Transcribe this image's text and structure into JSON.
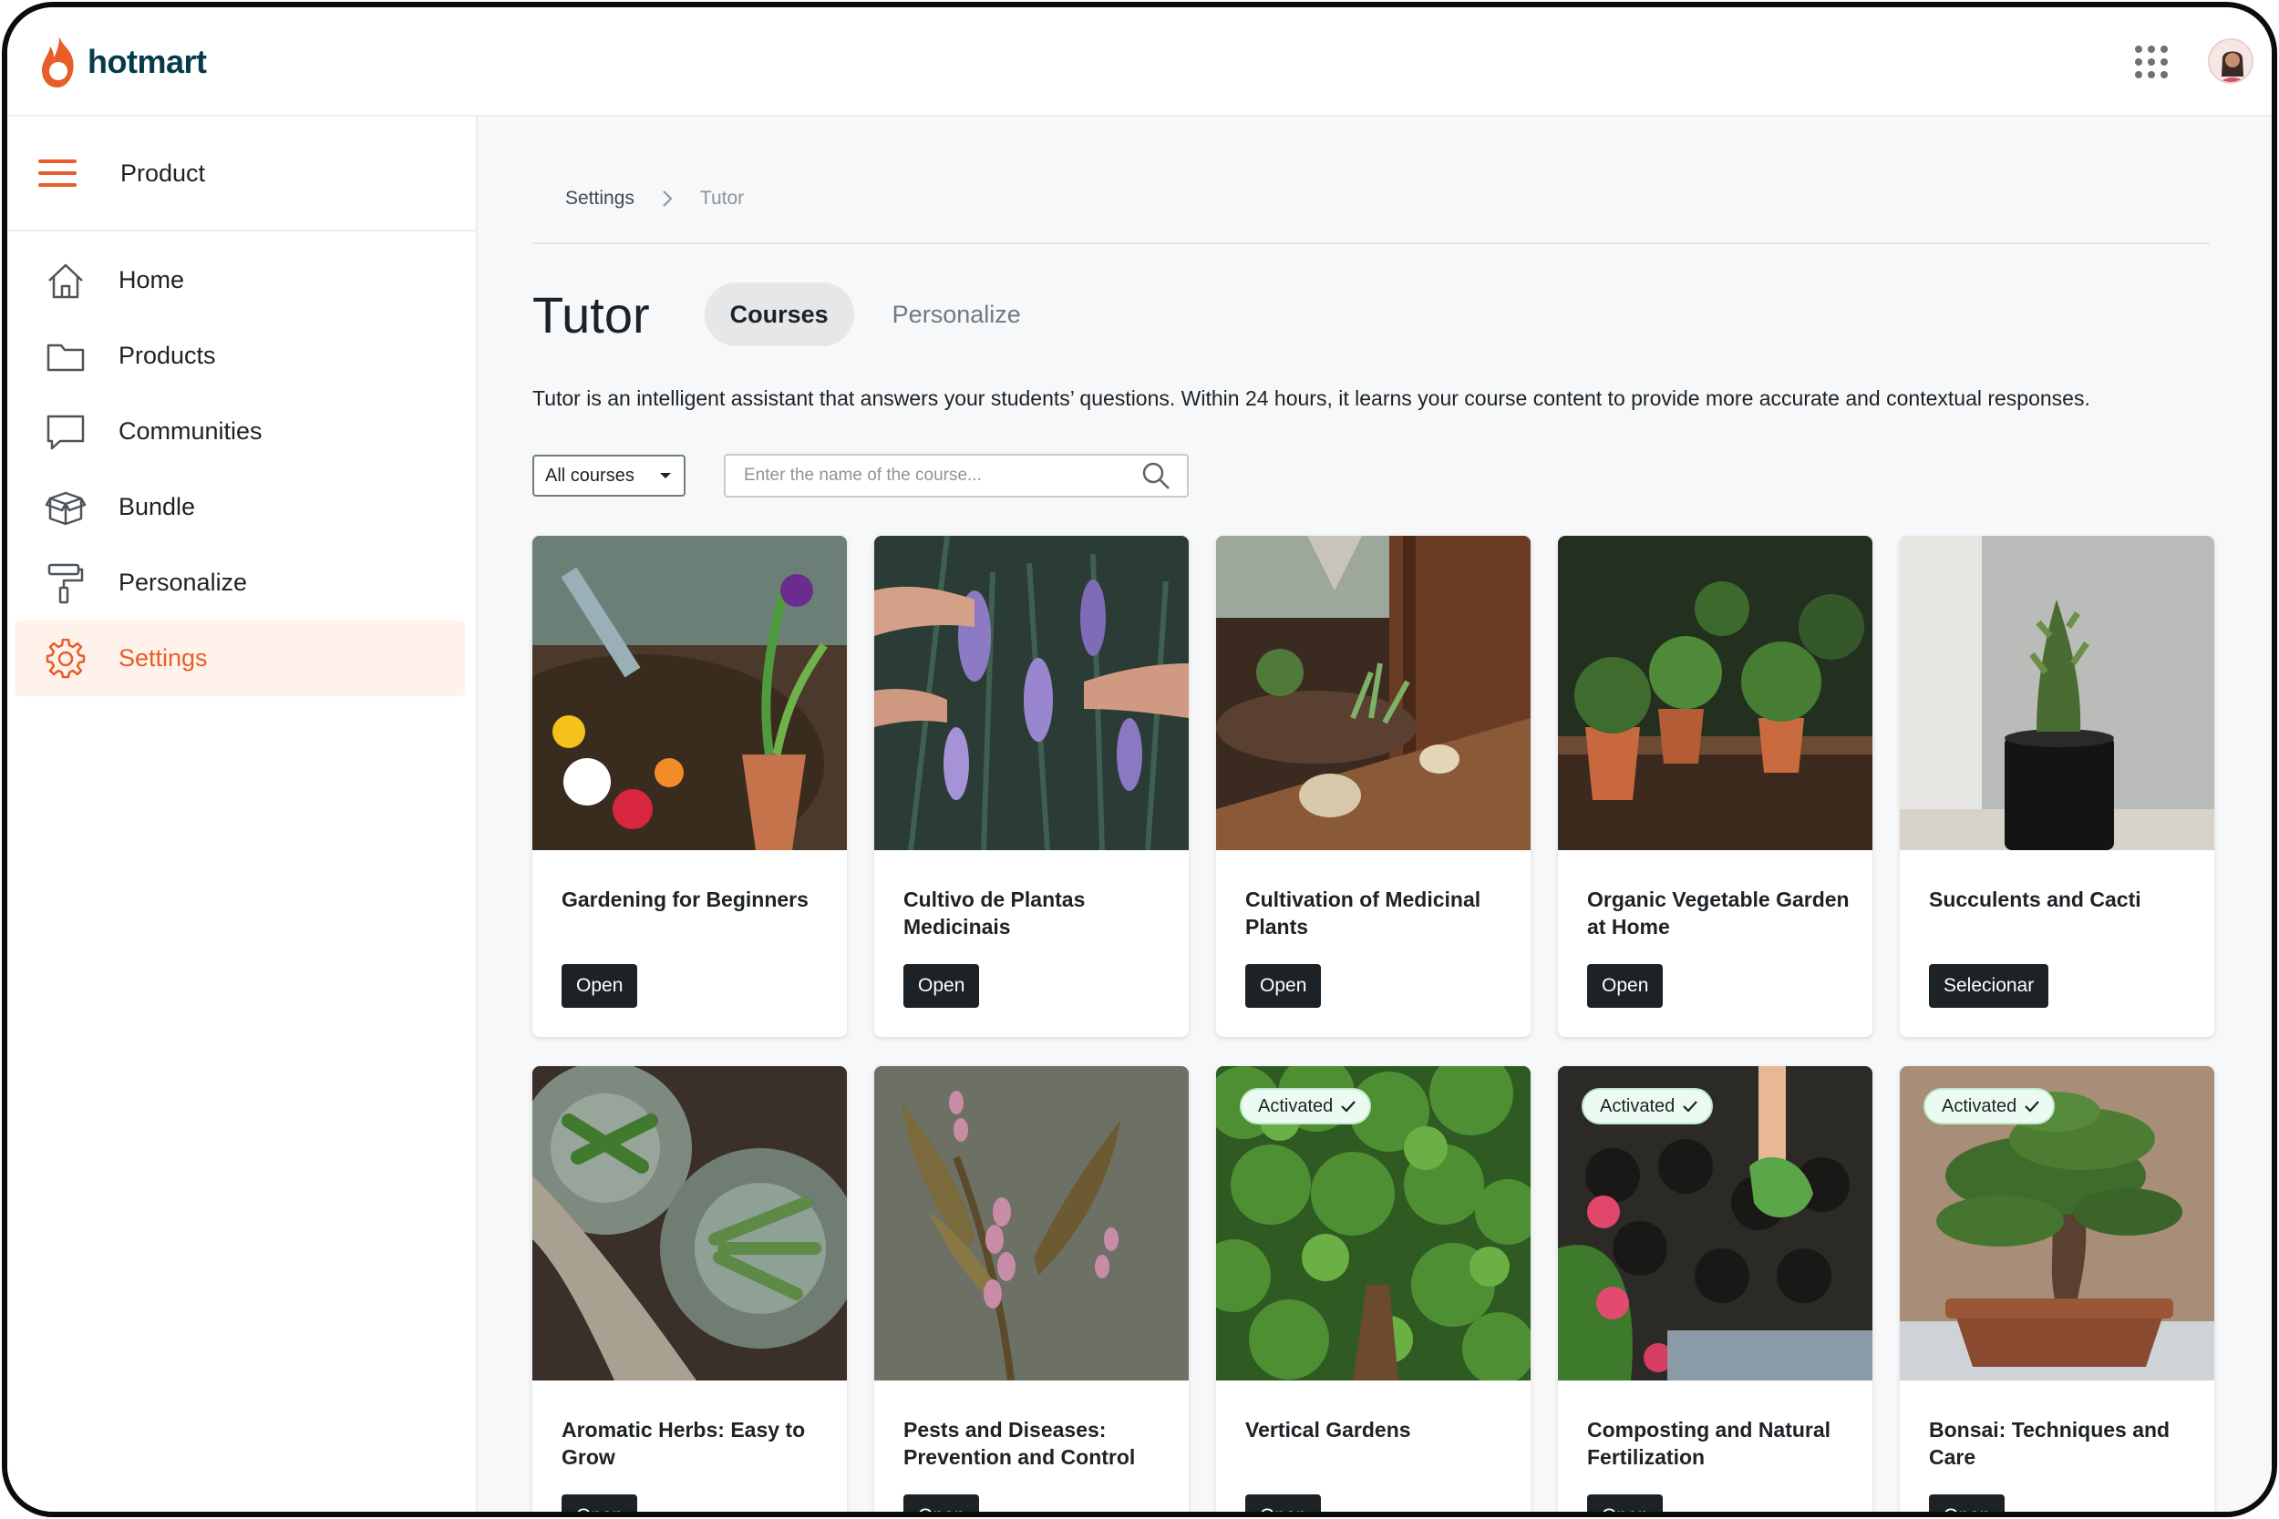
{
  "brand": {
    "name": "hotmart",
    "accent_color": "#e85d2a",
    "text_color": "#063b4b"
  },
  "topbar": {
    "apps_icon": "grid-dots-icon",
    "avatar_icon": "user-avatar"
  },
  "sidebar": {
    "header_label": "Product",
    "items": [
      {
        "label": "Home",
        "icon": "home-icon",
        "active": false
      },
      {
        "label": "Products",
        "icon": "folder-icon",
        "active": false
      },
      {
        "label": "Communities",
        "icon": "chat-icon",
        "active": false
      },
      {
        "label": "Bundle",
        "icon": "box-icon",
        "active": false
      },
      {
        "label": "Personalize",
        "icon": "paint-roller-icon",
        "active": false
      },
      {
        "label": "Settings",
        "icon": "gear-icon",
        "active": true
      }
    ]
  },
  "breadcrumb": {
    "items": [
      "Settings",
      "Tutor"
    ]
  },
  "page": {
    "title": "Tutor",
    "tabs": [
      {
        "label": "Courses",
        "active": true
      },
      {
        "label": "Personalize",
        "active": false
      }
    ],
    "description": "Tutor is an intelligent assistant that answers your students’ questions. Within 24 hours, it learns your course content to provide more accurate and contextual responses."
  },
  "filters": {
    "select_value": "All courses",
    "search_placeholder": "Enter the name of the course...",
    "search_value": ""
  },
  "courses": [
    {
      "title": "Gardening for Beginners",
      "button": "Open",
      "badge": ""
    },
    {
      "title": "Cultivo de Plantas Medicinais",
      "button": "Open",
      "badge": ""
    },
    {
      "title": "Cultivation of Medicinal Plants",
      "button": "Open",
      "badge": ""
    },
    {
      "title": "Organic Vegetable Garden at Home",
      "button": "Open",
      "badge": ""
    },
    {
      "title": "Succulents and Cacti",
      "button": "Selecionar",
      "badge": ""
    },
    {
      "title": "Aromatic Herbs: Easy to Grow",
      "button": "Open",
      "badge": ""
    },
    {
      "title": "Pests and Diseases: Prevention and Control",
      "button": "Open",
      "badge": ""
    },
    {
      "title": "Vertical Gardens",
      "button": "Open",
      "badge": "Activated"
    },
    {
      "title": "Composting and Natural Fertilization",
      "button": "Open",
      "badge": "Activated"
    },
    {
      "title": "Bonsai: Techniques and Care",
      "button": "Open",
      "badge": "Activated"
    }
  ]
}
